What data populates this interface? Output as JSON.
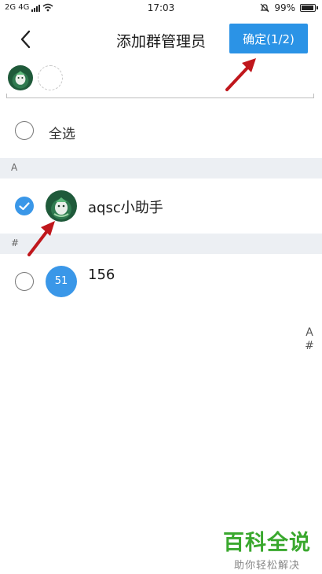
{
  "status_bar": {
    "network": "2G 4G",
    "time": "17:03",
    "battery": "99%",
    "battery_level": 0.99,
    "icons": [
      "signal-icon",
      "wifi-icon",
      "mute-bell-icon",
      "battery-icon"
    ]
  },
  "nav": {
    "back_icon": "back-chevron-icon",
    "title": "添加群管理员",
    "confirm_label": "确定(1/2)"
  },
  "select_all": {
    "label": "全选"
  },
  "sections": [
    {
      "header": "A",
      "contacts": [
        {
          "name": "aqsc小助手",
          "checked": true,
          "avatar": "mascot-avatar"
        }
      ]
    },
    {
      "header": "#",
      "contacts": [
        {
          "name": "156",
          "checked": false,
          "avatar_text": "51"
        }
      ]
    }
  ],
  "index_bar": [
    "A",
    "#"
  ],
  "colors": {
    "accent": "#2b93e6",
    "section_bg": "#eceff3",
    "watermark_green": "#3aa82e"
  },
  "watermark": {
    "title": "百科全说",
    "subtitle": "助你轻松解决"
  }
}
